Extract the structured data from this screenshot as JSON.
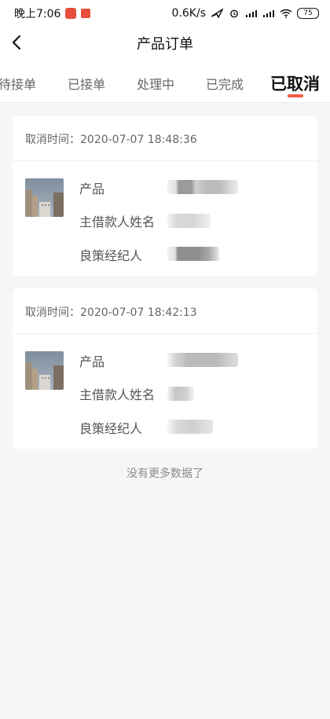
{
  "status_bar": {
    "time": "晚上7:06",
    "network_speed": "0.6K/s",
    "battery": "75",
    "icons": [
      "app-icon",
      "app-icon",
      "send-icon",
      "alarm-icon",
      "signal-icon",
      "signal-icon",
      "wifi-icon",
      "battery-icon"
    ]
  },
  "nav": {
    "title": "产品订单",
    "back_icon": "back-icon"
  },
  "tabs": [
    {
      "label": "待接单"
    },
    {
      "label": "已接单"
    },
    {
      "label": "处理中"
    },
    {
      "label": "已完成"
    },
    {
      "label": "已取消"
    }
  ],
  "orders": [
    {
      "time_label": "取消时间：2020-07-07 18:48:36",
      "product_label": "产品",
      "borrower_label": "主借款人姓名",
      "agent_label": "良策经纪人"
    },
    {
      "time_label": "取消时间：2020-07-07 18:42:13",
      "product_label": "产品",
      "borrower_label": "主借款人姓名",
      "agent_label": "良策经纪人"
    }
  ],
  "footer": {
    "text": "没有更多数据了"
  },
  "colors": {
    "accent": "#f25a45",
    "background": "#f6f6f8",
    "card": "#ffffff"
  }
}
